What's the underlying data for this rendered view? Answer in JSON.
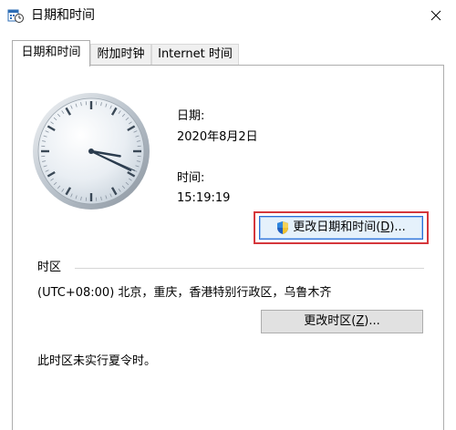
{
  "window": {
    "title": "日期和时间",
    "icon": "datetime-settings-icon",
    "close_icon": "close-icon"
  },
  "tabs": [
    {
      "label": "日期和时间",
      "active": true
    },
    {
      "label": "附加时钟",
      "active": false
    },
    {
      "label": "Internet 时间",
      "active": false
    }
  ],
  "date": {
    "label": "日期:",
    "value": "2020年8月2日"
  },
  "time": {
    "label": "时间:",
    "value": "15:19:19"
  },
  "clock": {
    "hour": 15,
    "minute": 19,
    "second": 19
  },
  "change_datetime_button": {
    "label": "更改日期和时间",
    "accel_prefix": "(",
    "accel_key": "D",
    "accel_suffix": ")...",
    "icon": "uac-shield-icon"
  },
  "timezone": {
    "heading": "时区",
    "value": "(UTC+08:00) 北京，重庆，香港特别行政区，乌鲁木齐",
    "button_label": "更改时区",
    "button_accel_prefix": "(",
    "button_accel_key": "Z",
    "button_accel_suffix": ")..."
  },
  "dst_note": "此时区未实行夏令时。",
  "colors": {
    "highlight": "#d5373c",
    "accent": "#2b6fd6"
  }
}
